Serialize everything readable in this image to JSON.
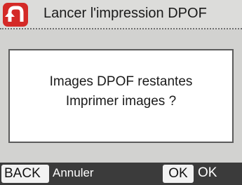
{
  "header": {
    "title": "Lancer l'impression DPOF",
    "back_icon": "return-arrow-icon",
    "accent_color": "#d42a27"
  },
  "dialog": {
    "line1": "Images DPOF restantes",
    "line2": "Imprimer images ?"
  },
  "footer": {
    "back_key": "BACK",
    "back_label": "Annuler",
    "ok_key": "OK",
    "ok_label": "OK"
  }
}
